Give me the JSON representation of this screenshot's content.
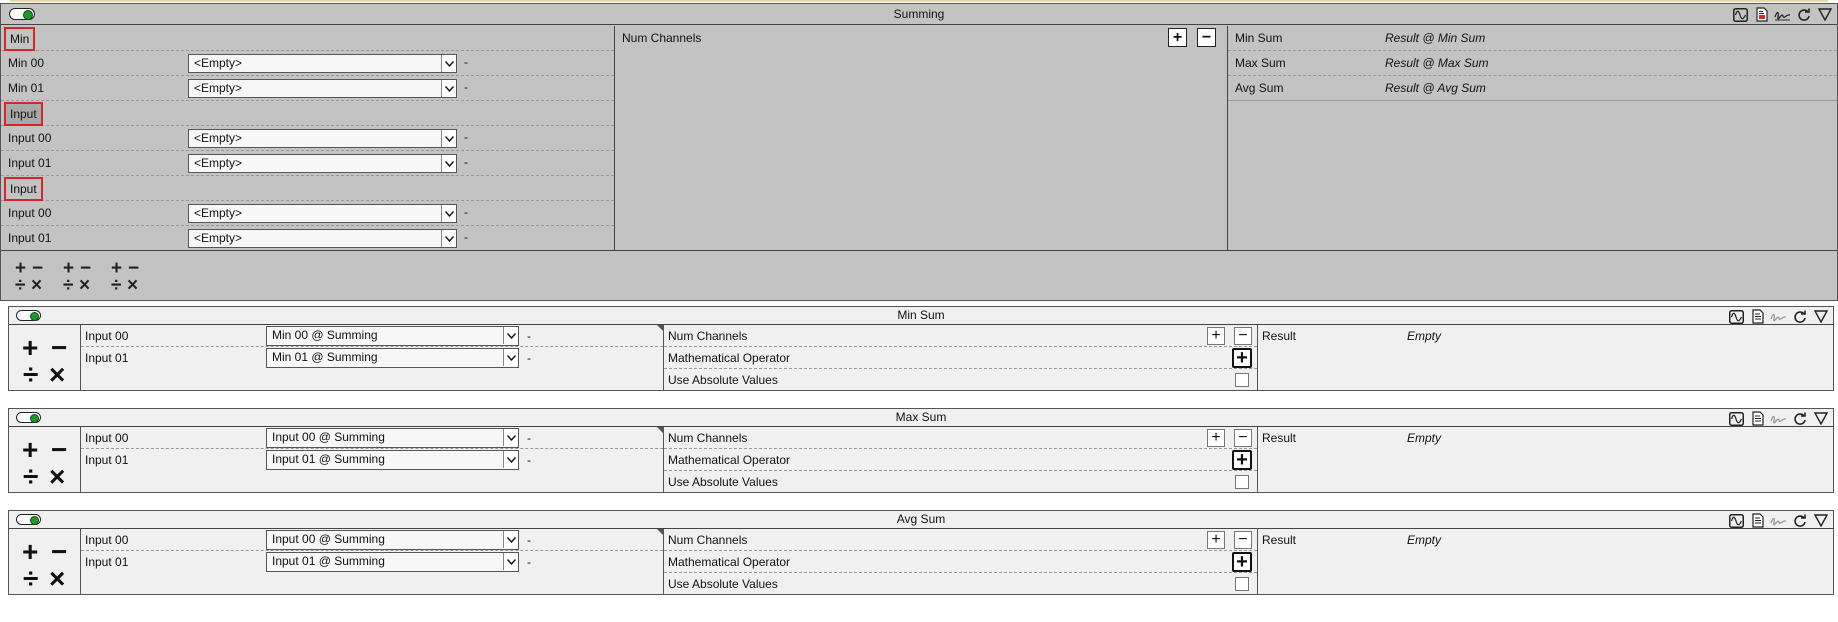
{
  "summing": {
    "title": "Summing",
    "toolbar_icons": [
      "waveform-icon",
      "document-icon",
      "signature-icon",
      "refresh-icon",
      "collapse-triangle-icon"
    ],
    "groups": [
      {
        "label": "Min",
        "items": [
          {
            "label": "Min 00",
            "value": "<Empty>",
            "unit": "-"
          },
          {
            "label": "Min 01",
            "value": "<Empty>",
            "unit": "-"
          }
        ]
      },
      {
        "label": "Input",
        "items": [
          {
            "label": "Input 00",
            "value": "<Empty>",
            "unit": "-"
          },
          {
            "label": "Input 01",
            "value": "<Empty>",
            "unit": "-"
          }
        ]
      },
      {
        "label": "Input",
        "items": [
          {
            "label": "Input 00",
            "value": "<Empty>",
            "unit": "-"
          },
          {
            "label": "Input 01",
            "value": "<Empty>",
            "unit": "-"
          }
        ]
      }
    ],
    "num_channels_label": "Num Channels",
    "outputs": [
      {
        "label": "Min Sum",
        "value": "Result @ Min Sum"
      },
      {
        "label": "Max Sum",
        "value": "Result @ Max Sum"
      },
      {
        "label": "Avg Sum",
        "value": "Result @ Avg Sum"
      }
    ],
    "ops_glyphs": [
      "+",
      "−",
      "÷",
      "×"
    ]
  },
  "sub_blocks": [
    {
      "title": "Min Sum",
      "inputs": [
        {
          "label": "Input 00",
          "value": "Min 00 @ Summing",
          "unit": "-"
        },
        {
          "label": "Input 01",
          "value": "Min 01 @ Summing",
          "unit": "-"
        }
      ],
      "params": {
        "num_channels": "Num Channels",
        "operator": "Mathematical Operator",
        "absolute": "Use Absolute Values",
        "use_absolute_checked": false
      },
      "result_label": "Result",
      "result_value": "Empty"
    },
    {
      "title": "Max Sum",
      "inputs": [
        {
          "label": "Input 00",
          "value": "Input 00 @ Summing",
          "unit": "-"
        },
        {
          "label": "Input 01",
          "value": "Input 01 @ Summing",
          "unit": "-"
        }
      ],
      "params": {
        "num_channels": "Num Channels",
        "operator": "Mathematical Operator",
        "absolute": "Use Absolute Values",
        "use_absolute_checked": false
      },
      "result_label": "Result",
      "result_value": "Empty"
    },
    {
      "title": "Avg Sum",
      "inputs": [
        {
          "label": "Input 00",
          "value": "Input 00 @ Summing",
          "unit": "-"
        },
        {
          "label": "Input 01",
          "value": "Input 01 @ Summing",
          "unit": "-"
        }
      ],
      "params": {
        "num_channels": "Num Channels",
        "operator": "Mathematical Operator",
        "absolute": "Use Absolute Values",
        "use_absolute_checked": false
      },
      "result_label": "Result",
      "result_value": "Empty"
    }
  ],
  "buttons": {
    "plus": "+",
    "minus": "−"
  },
  "colors": {
    "toggle_on": "#1f9a2a",
    "highlight_box": "#d6262a",
    "panel_bg": "#c3c3c3",
    "sub_bg": "#f0f0f0"
  }
}
